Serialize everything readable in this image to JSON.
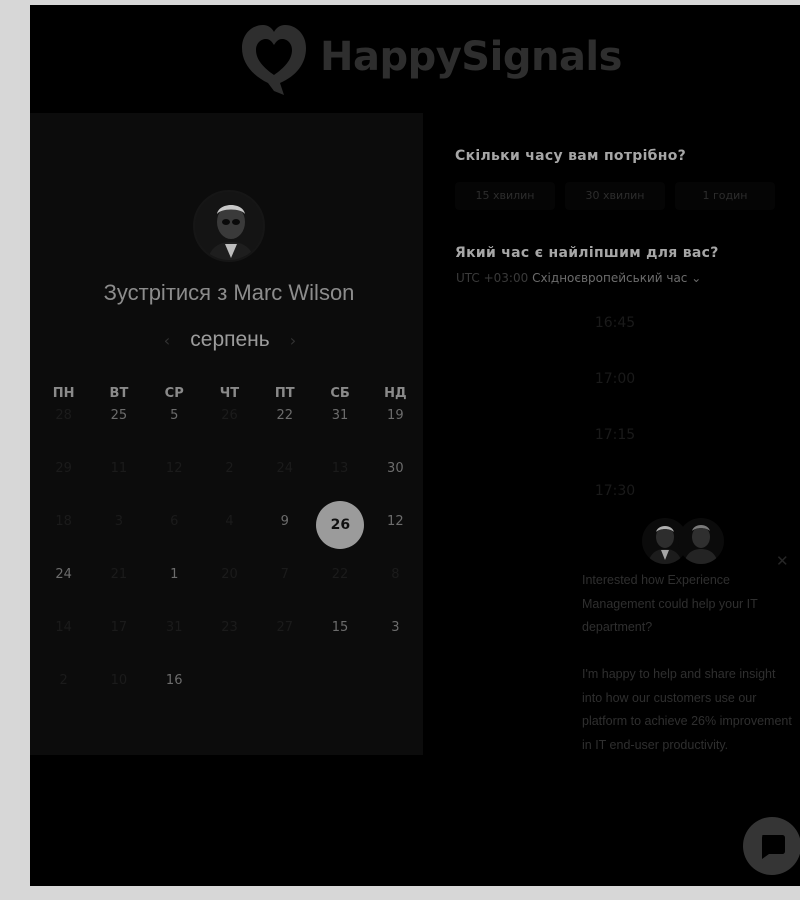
{
  "brand": {
    "name": "HappySignals"
  },
  "booking": {
    "title": "Зустрітися з Marc Wilson",
    "month": "серпень",
    "weekdays": [
      "ПН",
      "ВТ",
      "СР",
      "ЧТ",
      "ПТ",
      "СБ",
      "НД"
    ],
    "weeks": [
      [
        "28",
        "25",
        "5",
        "26",
        "22",
        "31",
        "19"
      ],
      [
        "29",
        "11",
        "12",
        "2",
        "24",
        "13",
        "30"
      ],
      [
        "18",
        "3",
        "6",
        "4",
        "9",
        "26",
        "12"
      ],
      [
        "24",
        "21",
        "1",
        "20",
        "7",
        "22",
        "8"
      ],
      [
        "14",
        "17",
        "31",
        "23",
        "27",
        "15",
        "3"
      ],
      [
        "2",
        "10",
        "16",
        "",
        "",
        "",
        ""
      ]
    ],
    "selected_day": "26"
  },
  "duration": {
    "question": "Скільки часу вам потрібно?",
    "options": [
      "15 хвилин",
      "30 хвилин",
      "1 годин"
    ]
  },
  "time": {
    "question": "Який час є найліпшим для вас?",
    "tz_offset": "UTC +03:00",
    "tz_name": "Східноєвропейський час",
    "slots": [
      "16:45",
      "17:00",
      "17:15",
      "17:30"
    ]
  },
  "chat": {
    "message1": "Interested how Experience Management could help your IT department?",
    "message2": "I'm happy to help and share insight into how our customers use our platform to achieve 26% improvement in IT end-user productivity."
  }
}
